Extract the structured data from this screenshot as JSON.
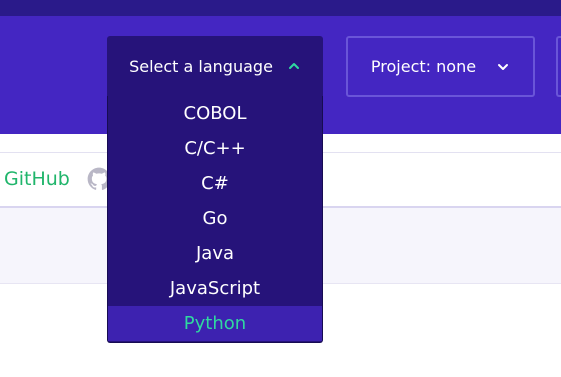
{
  "header": {
    "language_select": {
      "label": "Select a language",
      "icon": "chevron-up-icon",
      "accent": "#2fd9a0"
    },
    "project_select": {
      "label": "Project: none",
      "icon": "chevron-down-icon"
    }
  },
  "dropdown": {
    "options": [
      "COBOL",
      "C/C++",
      "C#",
      "Go",
      "Java",
      "JavaScript",
      "Python"
    ],
    "selected": "Python"
  },
  "content": {
    "github_link": "GitHub",
    "github_icon": "github-icon"
  },
  "colors": {
    "header_bg": "#4426c2",
    "top_strip": "#2a1a8a",
    "dropdown_bg": "#26137a",
    "selected_bg": "#3d22b0",
    "accent_green": "#2fd9a0",
    "link_green": "#20b56b"
  }
}
